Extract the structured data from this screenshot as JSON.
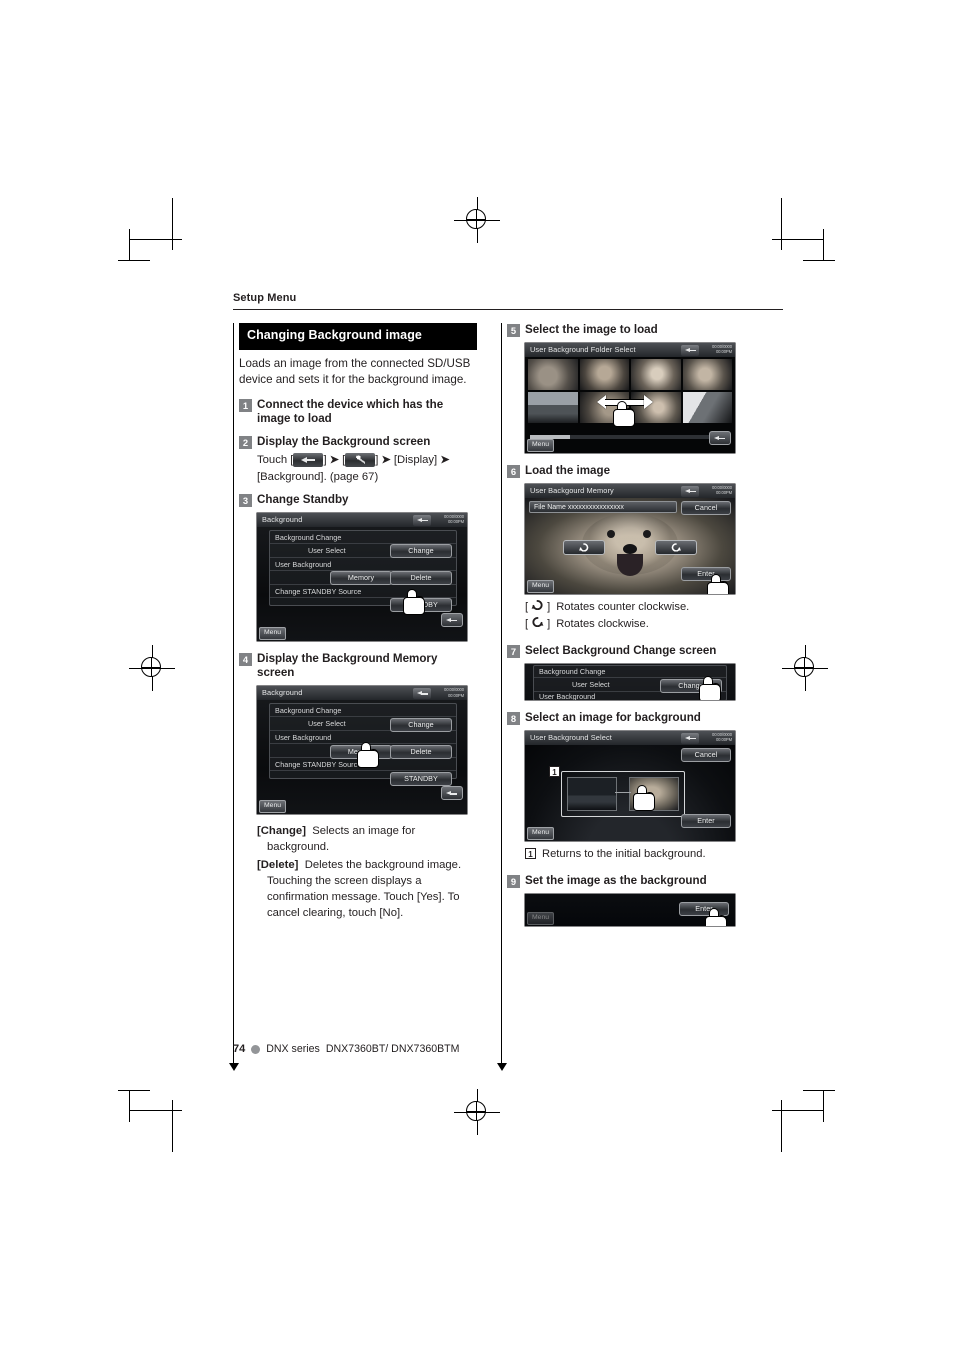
{
  "running_head": "Setup Menu",
  "section": {
    "title": "Changing Background image",
    "lead": "Loads an image from the connected SD/USB device and sets it for the background image."
  },
  "steps": [
    {
      "num": "1",
      "title": "Connect the device which has the image to load"
    },
    {
      "num": "2",
      "title": "Display the Background screen",
      "body_prefix": "Touch [",
      "body_mid1": "] ",
      "body_mid2": " [",
      "body_mid3": "] ",
      "body_display": "[Display]",
      "body_tail": "[Background]. (page 67)",
      "chevron": "➤"
    },
    {
      "num": "3",
      "title": "Change Standby"
    },
    {
      "num": "4",
      "title": "Display the Background Memory screen"
    },
    {
      "num": "5",
      "title": "Select the image to load"
    },
    {
      "num": "6",
      "title": "Load the image"
    },
    {
      "num": "7",
      "title": "Select Background Change screen"
    },
    {
      "num": "8",
      "title": "Select an image for background"
    },
    {
      "num": "9",
      "title": "Set the image as the background"
    }
  ],
  "definitions": [
    {
      "term": "[Change]",
      "text": "Selects an image for background."
    },
    {
      "term": "[Delete]",
      "text": "Deletes the background image. Touching the screen displays a confirmation message. Touch [Yes]. To cancel clearing, touch [No]."
    }
  ],
  "legends": [
    {
      "icon": "rotate-ccw-icon",
      "label": "[",
      "label2": "]",
      "text": "Rotates counter clockwise."
    },
    {
      "icon": "rotate-cw-icon",
      "label": "[",
      "label2": "]",
      "text": "Rotates clockwise."
    },
    {
      "icon": "callout-1",
      "label": "1",
      "text": "Returns to the initial background."
    }
  ],
  "screens": {
    "background": {
      "title": "Background",
      "clock_line1": "00:00/0000",
      "clock_line2": "00:00PM",
      "rows": [
        {
          "label": "Background Change"
        },
        {
          "label": "User Select",
          "button": "Change"
        },
        {
          "label": "User Background"
        },
        {
          "label": "",
          "button_a": "Memory",
          "button_b": "Delete"
        },
        {
          "label": "Change STANDBY Source"
        },
        {
          "label": "",
          "button": "STANDBY"
        }
      ],
      "menu": "Menu"
    },
    "folder_select": {
      "title": "User Background Folder Select",
      "clock_line1": "00:00/0000",
      "clock_line2": "00:00PM",
      "menu": "Menu"
    },
    "memory": {
      "title": "User Backgourd Memory",
      "clock_line1": "00:00/0000",
      "clock_line2": "00:00PM",
      "file_name": "File Name xxxxxxxxxxxxxxxx",
      "cancel": "Cancel",
      "enter": "Enter",
      "menu": "Menu"
    },
    "bg_change_strip": {
      "row1": "Background Change",
      "row2": "User Select",
      "row2_button": "Change",
      "row3": "User Background"
    },
    "bg_select": {
      "title": "User Background Select",
      "clock_line1": "00:00/0000",
      "clock_line2": "00:00PM",
      "cancel": "Cancel",
      "enter": "Enter",
      "menu": "Menu",
      "callout": "1"
    },
    "enter_strip": {
      "enter": "Enter",
      "menu": "Menu"
    }
  },
  "footer": {
    "page": "74",
    "series": "DNX series",
    "models": "DNX7360BT/ DNX7360BTM"
  }
}
